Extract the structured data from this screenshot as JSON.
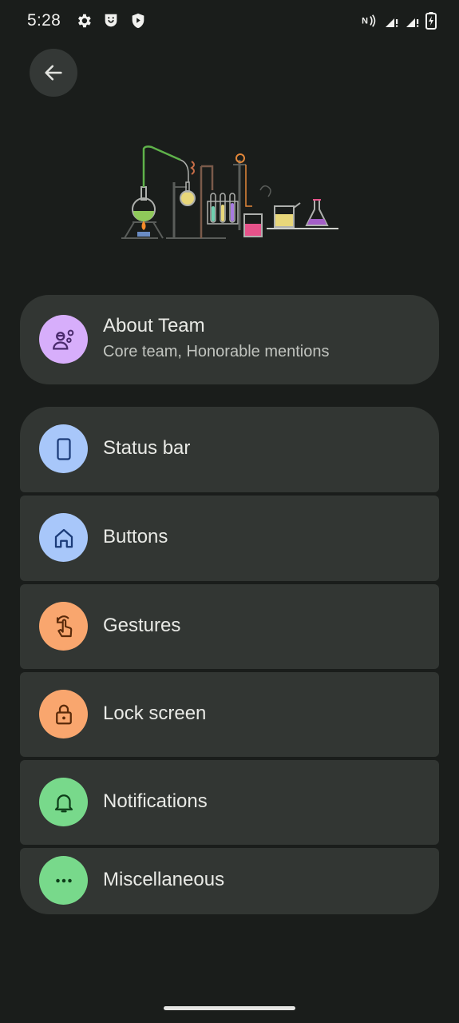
{
  "status_bar": {
    "time": "5:28",
    "left_icons": [
      "settings-gear-icon",
      "shield-face-icon",
      "shield-play-icon"
    ],
    "right_icons": [
      "nfc-icon",
      "signal-alert-icon",
      "signal-alert-icon",
      "battery-charging-icon"
    ]
  },
  "header": {
    "back_icon": "arrow-back-icon",
    "illustration": "chemistry-lab-illustration"
  },
  "about": {
    "title": "About Team",
    "subtitle": "Core team, Honorable mentions",
    "icon": "team-gears-icon",
    "icon_bg": "#d7aefb",
    "icon_fg": "#4a2a6c"
  },
  "menu": {
    "items": [
      {
        "label": "Status bar",
        "icon": "phone-outline-icon",
        "icon_bg": "#a8c7fa",
        "icon_fg": "#1b3b78"
      },
      {
        "label": "Buttons",
        "icon": "home-outline-icon",
        "icon_bg": "#a8c7fa",
        "icon_fg": "#1b3b78"
      },
      {
        "label": "Gestures",
        "icon": "swipe-gesture-icon",
        "icon_bg": "#f9a66e",
        "icon_fg": "#5a2a0a"
      },
      {
        "label": "Lock screen",
        "icon": "lock-icon",
        "icon_bg": "#f9a66e",
        "icon_fg": "#5a2a0a"
      },
      {
        "label": "Notifications",
        "icon": "bell-icon",
        "icon_bg": "#78d98b",
        "icon_fg": "#0d3d19"
      },
      {
        "label": "Miscellaneous",
        "icon": "more-dots-icon",
        "icon_bg": "#78d98b",
        "icon_fg": "#0d3d19"
      }
    ]
  },
  "colors": {
    "background": "#1a1d1b",
    "card": "#323633",
    "back_button": "#343836"
  }
}
